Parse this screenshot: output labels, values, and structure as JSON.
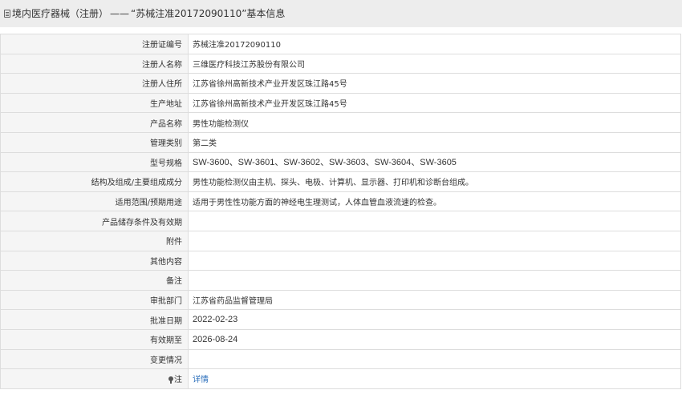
{
  "header": {
    "prefix": "境内医疗器械（注册）",
    "dash": "——",
    "title": "“苏械注准20172090110”基本信息"
  },
  "rows": [
    {
      "label": "注册证编号",
      "value": "苏械注准20172090110"
    },
    {
      "label": "注册人名称",
      "value": "三维医疗科技江苏股份有限公司"
    },
    {
      "label": "注册人住所",
      "value": "江苏省徐州高新技术产业开发区珠江路45号"
    },
    {
      "label": "生产地址",
      "value": "江苏省徐州高新技术产业开发区珠江路45号"
    },
    {
      "label": "产品名称",
      "value": "男性功能检测仪"
    },
    {
      "label": "管理类别",
      "value": "第二类"
    },
    {
      "label": "型号规格",
      "value": "SW-3600、SW-3601、SW-3602、SW-3603、SW-3604、SW-3605"
    },
    {
      "label": "结构及组成/主要组成成分",
      "value": "男性功能检测仪由主机、探头、电极、计算机、显示器、打印机和诊断台组成。"
    },
    {
      "label": "适用范围/预期用途",
      "value": "适用于男性性功能方面的神经电生理测试，人体血管血液流速的检查。"
    },
    {
      "label": "产品储存条件及有效期",
      "value": ""
    },
    {
      "label": "附件",
      "value": ""
    },
    {
      "label": "其他内容",
      "value": ""
    },
    {
      "label": "备注",
      "value": ""
    },
    {
      "label": "审批部门",
      "value": "江苏省药品监督管理局"
    },
    {
      "label": "批准日期",
      "value": "2022-02-23"
    },
    {
      "label": "有效期至",
      "value": "2026-08-24"
    },
    {
      "label": "变更情况",
      "value": ""
    },
    {
      "label": "注",
      "value": "详情"
    }
  ]
}
